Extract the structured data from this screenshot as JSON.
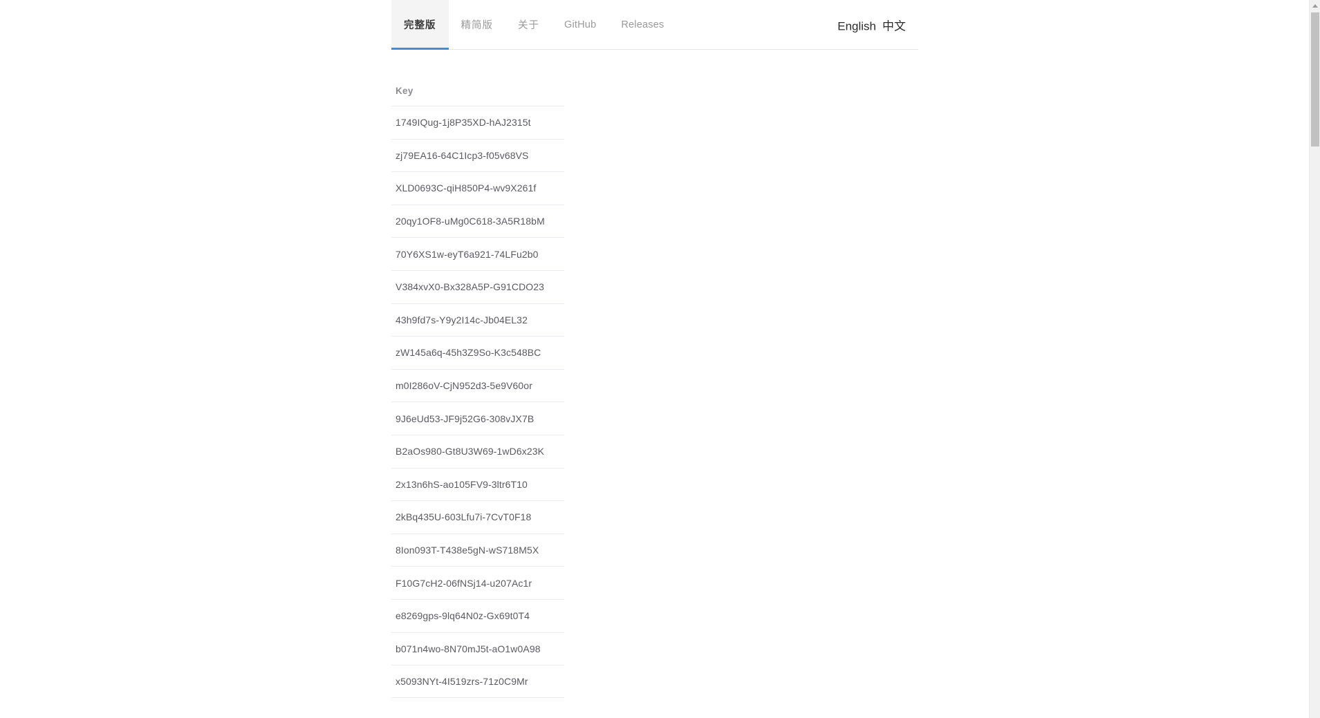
{
  "nav": {
    "tabs": [
      {
        "label": "完整版",
        "name": "tab-full",
        "active": true
      },
      {
        "label": "精简版",
        "name": "tab-lite",
        "active": false
      },
      {
        "label": "关于",
        "name": "tab-about",
        "active": false
      },
      {
        "label": "GitHub",
        "name": "tab-github",
        "active": false
      },
      {
        "label": "Releases",
        "name": "tab-releases",
        "active": false
      }
    ],
    "active_underline_color": "#3e8ee0",
    "active_tab_bg": "#f4f4f4"
  },
  "language": {
    "english": "English",
    "chinese": "中文"
  },
  "table": {
    "header": "Key",
    "rows": [
      "1749IQug-1j8P35XD-hAJ2315t",
      "zj79EA16-64C1Icp3-f05v68VS",
      "XLD0693C-qiH850P4-wv9X261f",
      "20qy1OF8-uMg0C618-3A5R18bM",
      "70Y6XS1w-eyT6a921-74LFu2b0",
      "V384xvX0-Bx328A5P-G91CDO23",
      "43h9fd7s-Y9y2I14c-Jb04EL32",
      "zW145a6q-45h3Z9So-K3c548BC",
      "m0I286oV-CjN952d3-5e9V60or",
      "9J6eUd53-JF9j52G6-308vJX7B",
      "B2aOs980-Gt8U3W69-1wD6x23K",
      "2x13n6hS-ao105FV9-3ltr6T10",
      "2kBq435U-603Lfu7i-7CvT0F18",
      "8Ion093T-T438e5gN-wS718M5X",
      "F10G7cH2-06fNSj14-u207Ac1r",
      "e8269gps-9lq64N0z-Gx69t0T4",
      "b071n4wo-8N70mJ5t-aO1w0A98",
      "x5093NYt-4I519zrs-71z0C9Mr"
    ]
  },
  "scrollbar": {
    "up_arrow_icon": "chevron-up-icon",
    "thumb_color": "#c1c1c1",
    "track_color": "#f1f1f1"
  }
}
